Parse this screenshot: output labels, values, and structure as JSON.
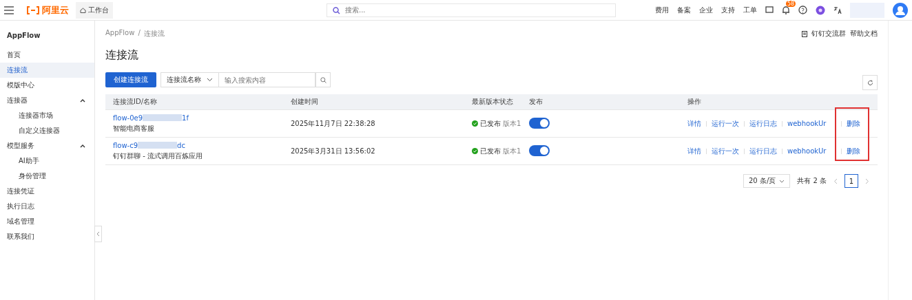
{
  "topbar": {
    "logo": "阿里云",
    "workbench": "工作台",
    "search_placeholder": "搜索...",
    "links": [
      "费用",
      "备案",
      "企业",
      "支持",
      "工单"
    ],
    "notification_badge": "58"
  },
  "sidebar": {
    "title": "AppFlow",
    "items": [
      {
        "label": "首页",
        "selected": false
      },
      {
        "label": "连接流",
        "selected": true
      },
      {
        "label": "模版中心",
        "selected": false
      },
      {
        "label": "连接器",
        "selected": false,
        "expanded": true,
        "children": [
          {
            "label": "连接器市场",
            "selected": false
          },
          {
            "label": "自定义连接器",
            "selected": false
          }
        ]
      },
      {
        "label": "模型服务",
        "selected": false,
        "expanded": true,
        "children": [
          {
            "label": "AI助手",
            "selected": false
          },
          {
            "label": "身份管理",
            "selected": false
          }
        ]
      },
      {
        "label": "连接凭证",
        "selected": false
      },
      {
        "label": "执行日志",
        "selected": false
      },
      {
        "label": "域名管理",
        "selected": false
      },
      {
        "label": "联系我们",
        "selected": false
      }
    ]
  },
  "breadcrumb": [
    "AppFlow",
    "连接流"
  ],
  "breadcrumb_separator": "/",
  "header_links": [
    "钉钉交流群",
    "帮助文档"
  ],
  "page_title": "连接流",
  "create_button": "创建连接流",
  "filter": {
    "field": "连接流名称",
    "placeholder": "输入搜索内容"
  },
  "table": {
    "columns": [
      "连接流ID/名称",
      "创建时间",
      "最新版本状态",
      "发布",
      "操作"
    ],
    "rows": [
      {
        "id_start": "flow-0e9",
        "id_end": "1f",
        "name": "智能电商客服",
        "created": "2025年11月7日 22:38:28",
        "status": "已发布",
        "version": "版本1",
        "published": true,
        "actions": [
          "详情",
          "运行一次",
          "运行日志",
          "webhookUr",
          "删除"
        ]
      },
      {
        "id_start": "flow-c9",
        "id_end": "dc",
        "name": "钉钉群聊 - 流式调用百炼应用",
        "created": "2025年3月31日 13:56:02",
        "status": "已发布",
        "version": "版本1",
        "published": true,
        "actions": [
          "详情",
          "运行一次",
          "运行日志",
          "webhookUr",
          "删除"
        ]
      }
    ]
  },
  "pagination": {
    "page_size": "20 条/页",
    "total": "共有 2 条",
    "pages": [
      {
        "label": "1",
        "selected": true
      }
    ]
  }
}
